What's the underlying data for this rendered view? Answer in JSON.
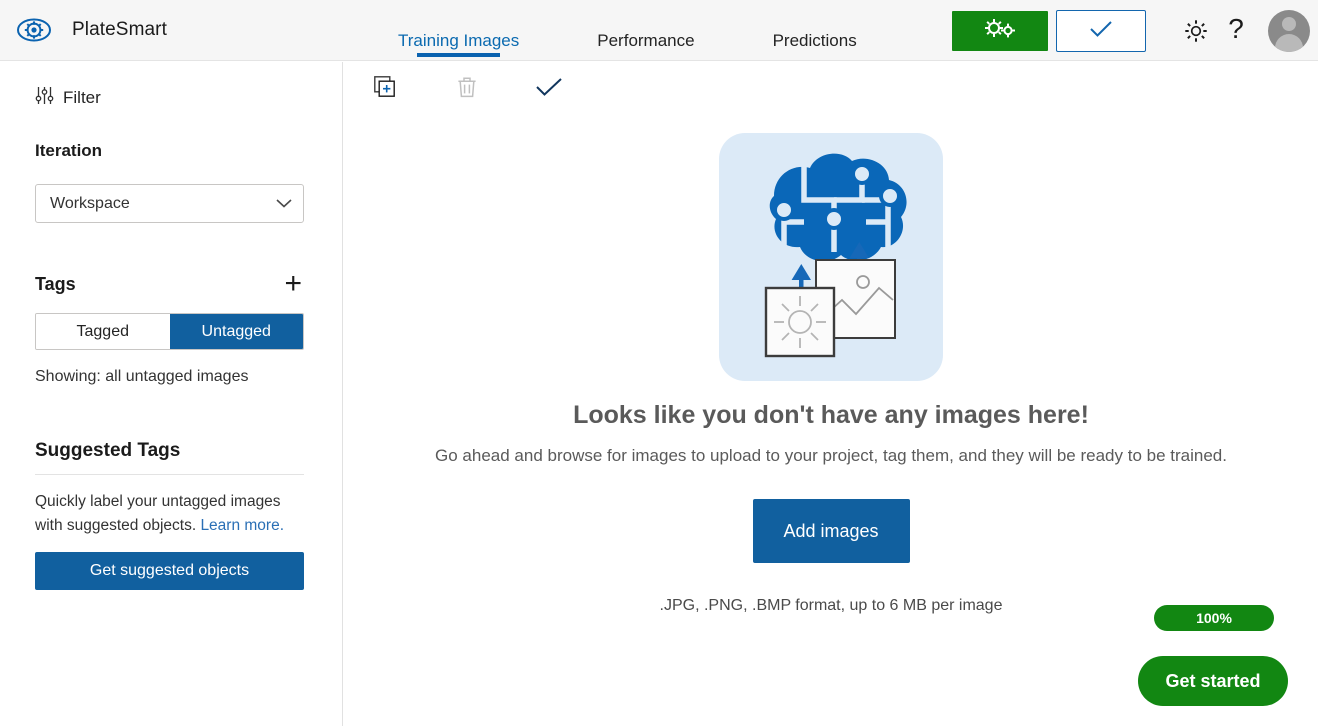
{
  "header": {
    "logo_icon": "eye-gear-logo-icon",
    "brand_name": "PlateSmart",
    "tabs": [
      {
        "label": "Training Images",
        "active": true
      },
      {
        "label": "Performance",
        "active": false
      },
      {
        "label": "Predictions",
        "active": false
      }
    ],
    "train_button": {
      "icon": "double-gear-icon",
      "color": "#128712"
    },
    "quick_test_button": {
      "icon": "checkmark-icon",
      "border_color": "#1366ae"
    },
    "settings_icon": "gear-icon",
    "help_icon": "question-mark-icon",
    "avatar": "user-avatar-icon"
  },
  "sidebar": {
    "filter": {
      "icon": "filter-sliders-icon",
      "label": "Filter"
    },
    "iteration": {
      "title": "Iteration",
      "selected": "Workspace",
      "chevron_icon": "chevron-down-icon"
    },
    "tags": {
      "title": "Tags",
      "add_icon": "plus-icon",
      "options": [
        {
          "label": "Tagged",
          "active": false
        },
        {
          "label": "Untagged",
          "active": true
        }
      ],
      "showing_text": "Showing: all untagged images"
    },
    "suggested_tags": {
      "title": "Suggested Tags",
      "description_before": "Quickly label your untagged images with suggested objects. ",
      "learn_more": "Learn more.",
      "button_label": "Get suggested objects"
    }
  },
  "main": {
    "toolbar": [
      {
        "name": "add-images-icon",
        "label": "Add images",
        "disabled": false
      },
      {
        "name": "trash-icon",
        "label": "Delete",
        "disabled": true
      },
      {
        "name": "checkmark-icon",
        "label": "Select all",
        "disabled": false
      }
    ],
    "empty_state": {
      "illustration": "brain-upload-images-illustration",
      "title": "Looks like you don't have any images here!",
      "subtitle": "Go ahead and browse for images to upload to your project, tag them, and they will be ready to be trained.",
      "add_button_label": "Add images",
      "format_note": ".JPG, .PNG, .BMP format, up to 6 MB per image"
    }
  },
  "overlay": {
    "progress_badge": "100%",
    "get_started_label": "Get started",
    "accent_green": "#128712",
    "accent_blue": "#11609f"
  }
}
